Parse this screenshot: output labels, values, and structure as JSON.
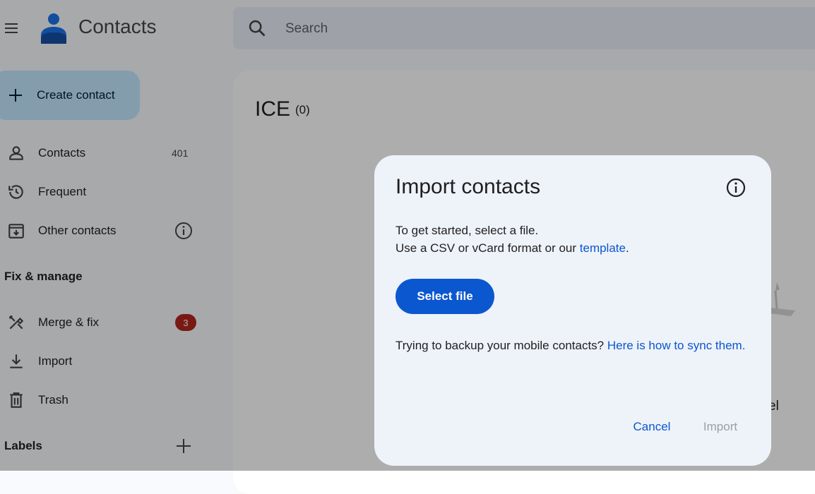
{
  "app": {
    "title": "Contacts"
  },
  "search": {
    "placeholder": "Search"
  },
  "sidebar": {
    "create_label": "Create contact",
    "items": [
      {
        "label": "Contacts",
        "count": "401",
        "icon": "person-icon"
      },
      {
        "label": "Frequent",
        "icon": "history-icon"
      },
      {
        "label": "Other contacts",
        "icon": "archive-icon"
      }
    ],
    "fix_heading": "Fix & manage",
    "fix_items": [
      {
        "label": "Merge & fix",
        "badge": "3",
        "icon": "tools-icon"
      },
      {
        "label": "Import",
        "icon": "download-icon"
      },
      {
        "label": "Trash",
        "icon": "trash-icon"
      }
    ],
    "labels_heading": "Labels"
  },
  "main": {
    "title": "ICE",
    "count": "(0)",
    "bg_text": "el"
  },
  "dialog": {
    "title": "Import contacts",
    "line1": "To get started, select a file.",
    "line2_prefix": "Use a CSV or vCard format or our ",
    "line2_link": "template",
    "line2_suffix": ".",
    "select_file": "Select file",
    "backup_prefix": "Trying to backup your mobile contacts? ",
    "backup_link": "Here is how to sync them.",
    "cancel": "Cancel",
    "import": "Import"
  },
  "colors": {
    "accent": "#0b57d0",
    "create_bg": "#c2e7ff",
    "badge": "#b3261e"
  }
}
